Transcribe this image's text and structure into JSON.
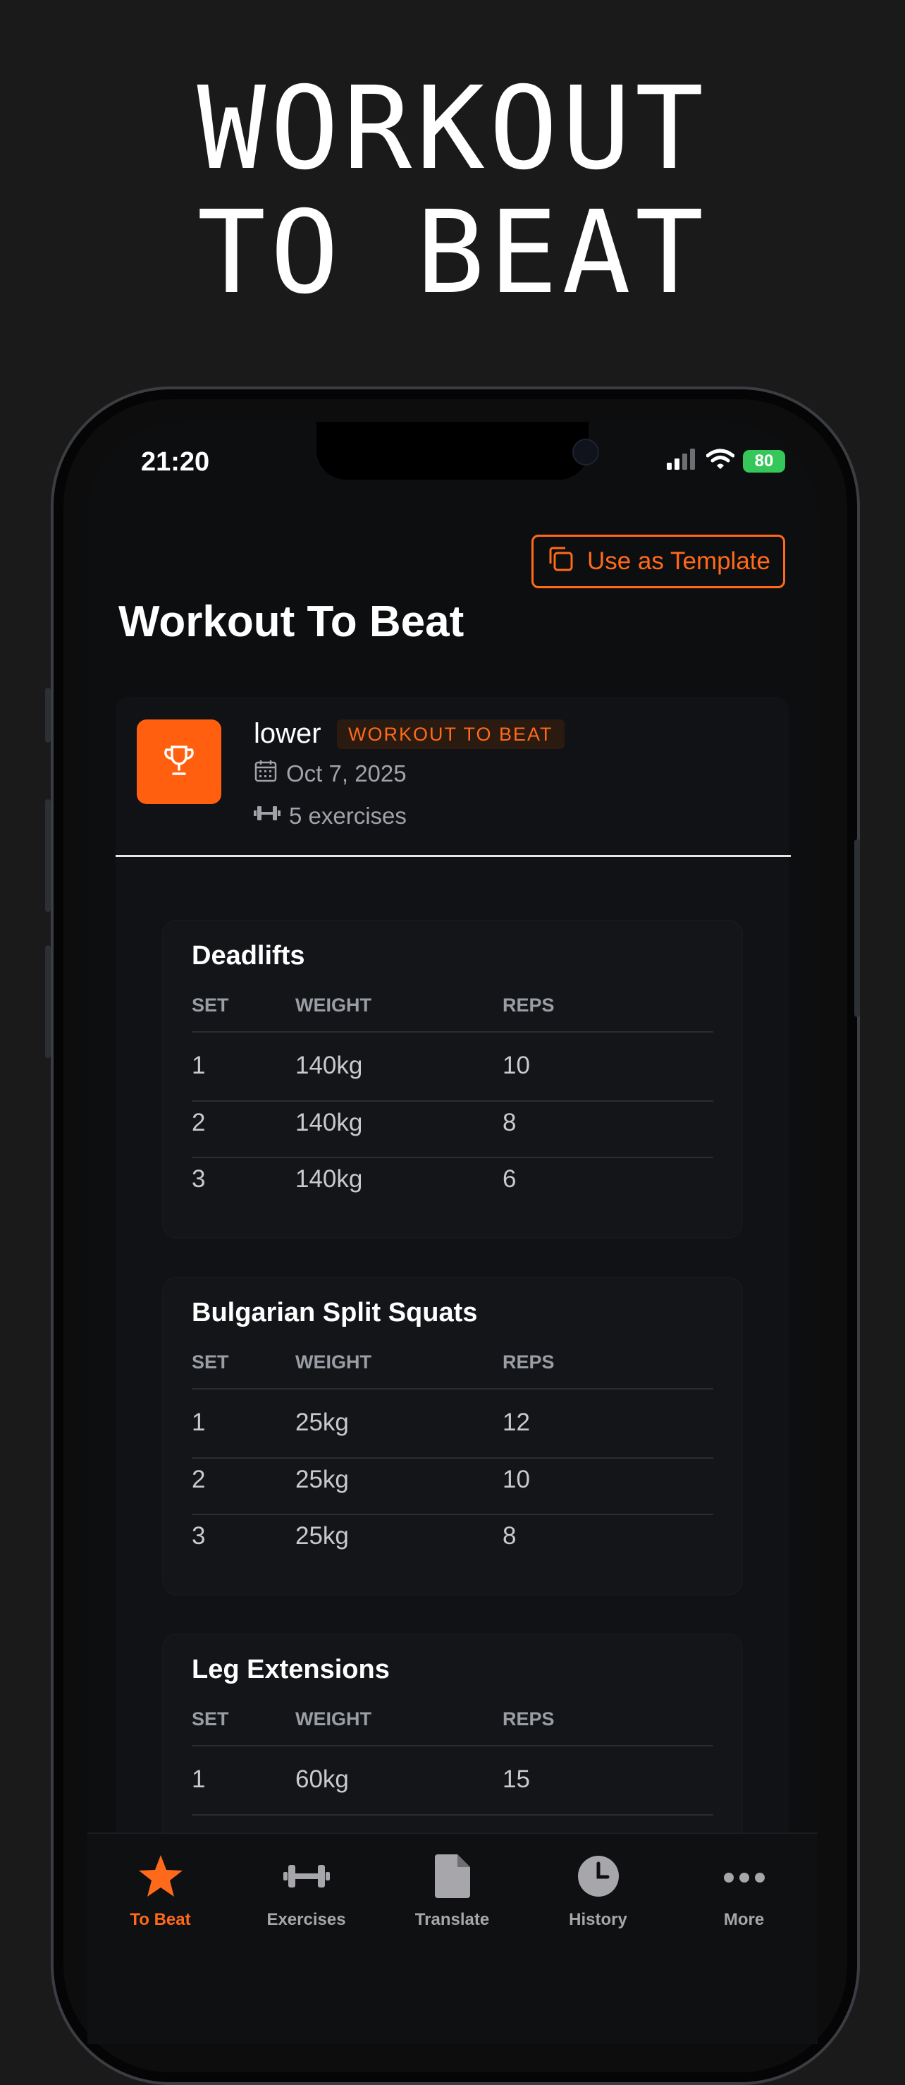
{
  "promo": {
    "headline_line1": "WORKOUT",
    "headline_line2": "TO BEAT"
  },
  "status_bar": {
    "time": "21:20",
    "battery": "80"
  },
  "header": {
    "template_button": "Use as Template",
    "title": "Workout To Beat"
  },
  "workout": {
    "name": "lower",
    "badge": "WORKOUT TO BEAT",
    "date": "Oct 7, 2025",
    "exercise_count": "5 exercises"
  },
  "table_headers": {
    "set": "SET",
    "weight": "WEIGHT",
    "reps": "REPS"
  },
  "exercises": [
    {
      "name": "Deadlifts",
      "sets": [
        {
          "set": "1",
          "weight": "140kg",
          "reps": "10"
        },
        {
          "set": "2",
          "weight": "140kg",
          "reps": "8"
        },
        {
          "set": "3",
          "weight": "140kg",
          "reps": "6"
        }
      ]
    },
    {
      "name": "Bulgarian Split Squats",
      "sets": [
        {
          "set": "1",
          "weight": "25kg",
          "reps": "12"
        },
        {
          "set": "2",
          "weight": "25kg",
          "reps": "10"
        },
        {
          "set": "3",
          "weight": "25kg",
          "reps": "8"
        }
      ]
    },
    {
      "name": "Leg Extensions",
      "sets": [
        {
          "set": "1",
          "weight": "60kg",
          "reps": "15"
        }
      ]
    }
  ],
  "tabbar": {
    "items": [
      {
        "label": "To Beat",
        "icon": "star-icon"
      },
      {
        "label": "Exercises",
        "icon": "dumbbell-icon"
      },
      {
        "label": "Translate",
        "icon": "document-icon"
      },
      {
        "label": "History",
        "icon": "clock-icon"
      },
      {
        "label": "More",
        "icon": "more-dots-icon"
      }
    ],
    "active_index": 0
  },
  "colors": {
    "accent": "#ff6a1a",
    "background": "#0d0e10",
    "card": "#131519"
  }
}
